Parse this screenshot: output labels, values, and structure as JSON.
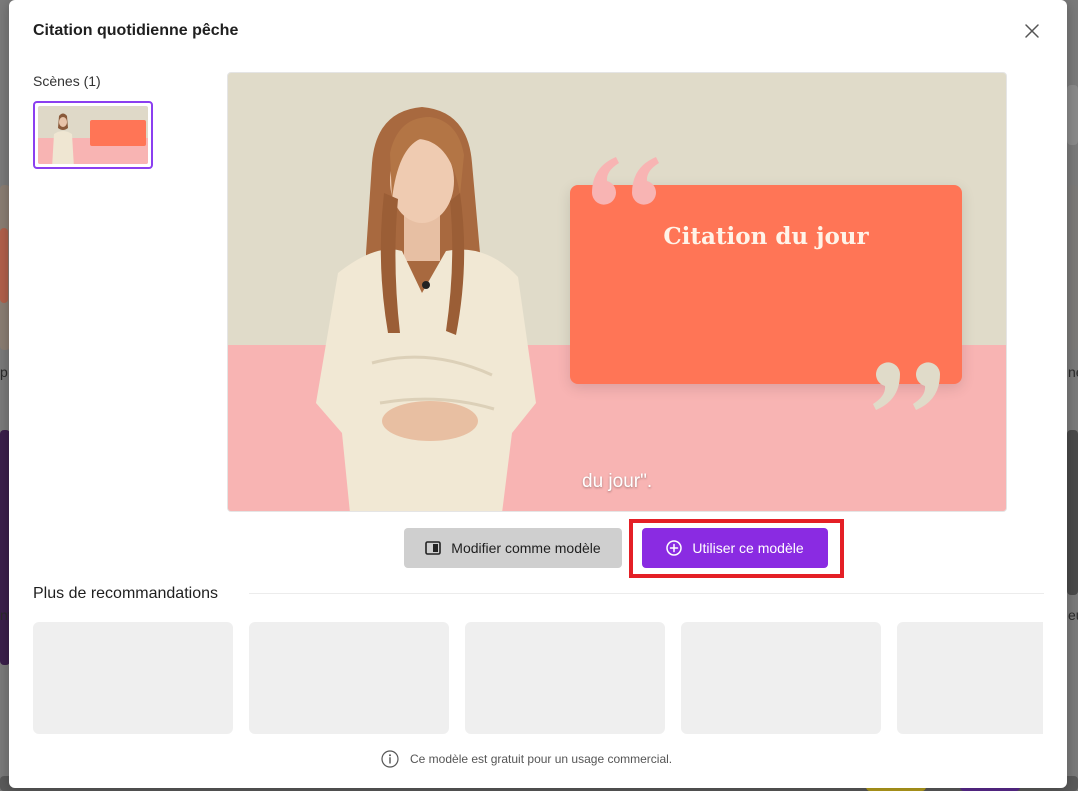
{
  "modal": {
    "title": "Citation quotidienne pêche",
    "close_icon": "close-icon"
  },
  "scenes": {
    "label": "Scènes (1)",
    "thumb_alt": "scene-1"
  },
  "preview": {
    "quote_title": "Citation du jour",
    "subtitle": "du jour\".",
    "colors": {
      "beige": "#e0dbc9",
      "pink": "#f8b4b3",
      "orange": "#ff7556"
    }
  },
  "actions": {
    "modify_label": "Modifier comme modèle",
    "use_label": "Utiliser ce modèle",
    "accent": "#8a2be2",
    "highlight": "#e41f26"
  },
  "recommendations": {
    "title": "Plus de recommandations",
    "cards": [
      "",
      "",
      "",
      "",
      ""
    ]
  },
  "footer": {
    "note": "Ce modèle est gratuit pour un usage commercial.",
    "icon": "info-icon"
  }
}
